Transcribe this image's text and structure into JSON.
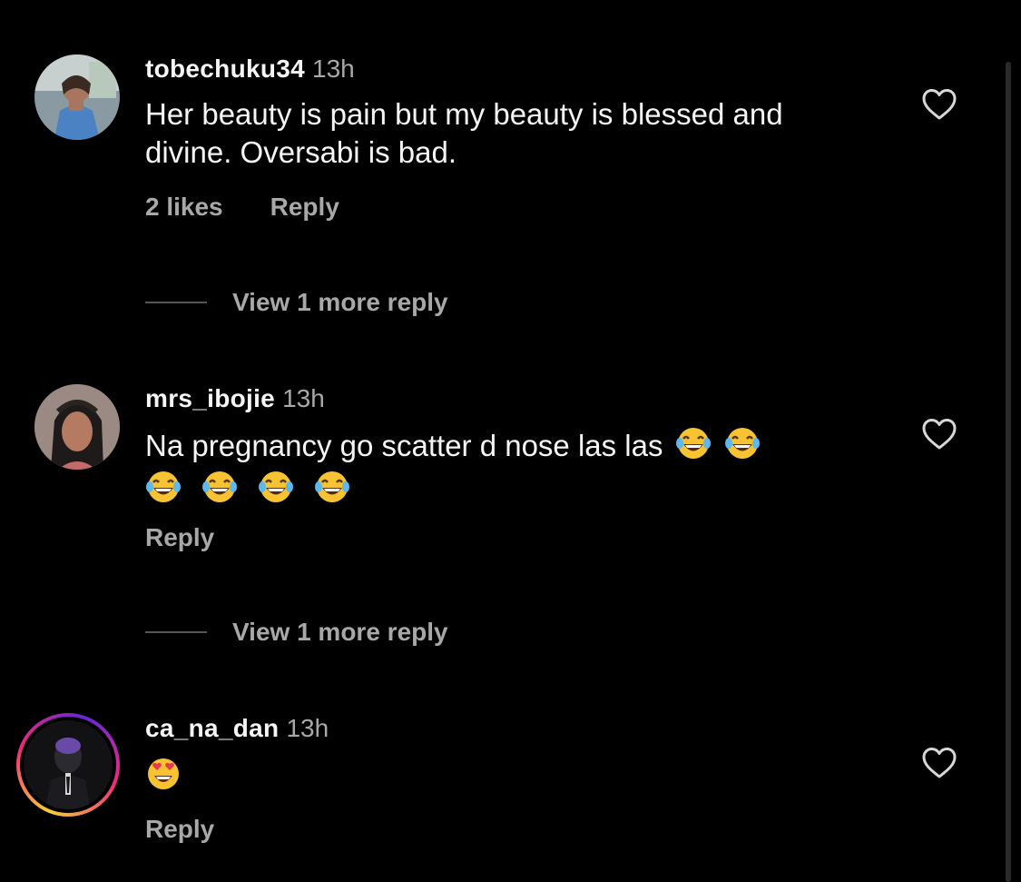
{
  "comments": [
    {
      "username": "tobechuku34",
      "time": "13h",
      "text": "Her beauty is pain but my beauty is blessed and divine. Oversabi is bad.",
      "likes": "2 likes",
      "reply": "Reply",
      "view_more": "View 1 more reply",
      "avatar": "avatar-photo-woman-blue-dress",
      "has_story_ring": false
    },
    {
      "username": "mrs_ibojie",
      "time": "13h",
      "text": "Na pregnancy go scatter d nose las las",
      "emojis_inline": [
        "face-with-tears-of-joy",
        "face-with-tears-of-joy"
      ],
      "emojis_next_line": [
        "face-with-tears-of-joy",
        "face-with-tears-of-joy",
        "face-with-tears-of-joy",
        "face-with-tears-of-joy"
      ],
      "reply": "Reply",
      "view_more": "View 1 more reply",
      "avatar": "avatar-photo-woman-braids",
      "has_story_ring": false
    },
    {
      "username": "ca_na_dan",
      "time": "13h",
      "emojis_inline": [
        "smiling-face-with-heart-eyes"
      ],
      "reply": "Reply",
      "avatar": "avatar-photo-masked-figure",
      "has_story_ring": true
    }
  ],
  "icons": {
    "like": "heart-outline-icon"
  },
  "colors": {
    "background": "#000000",
    "primary_text": "#f5f5f5",
    "secondary_text": "#a8a8a8",
    "story_ring": [
      "#f9ce34",
      "#ee2a7b",
      "#6228d7"
    ]
  }
}
